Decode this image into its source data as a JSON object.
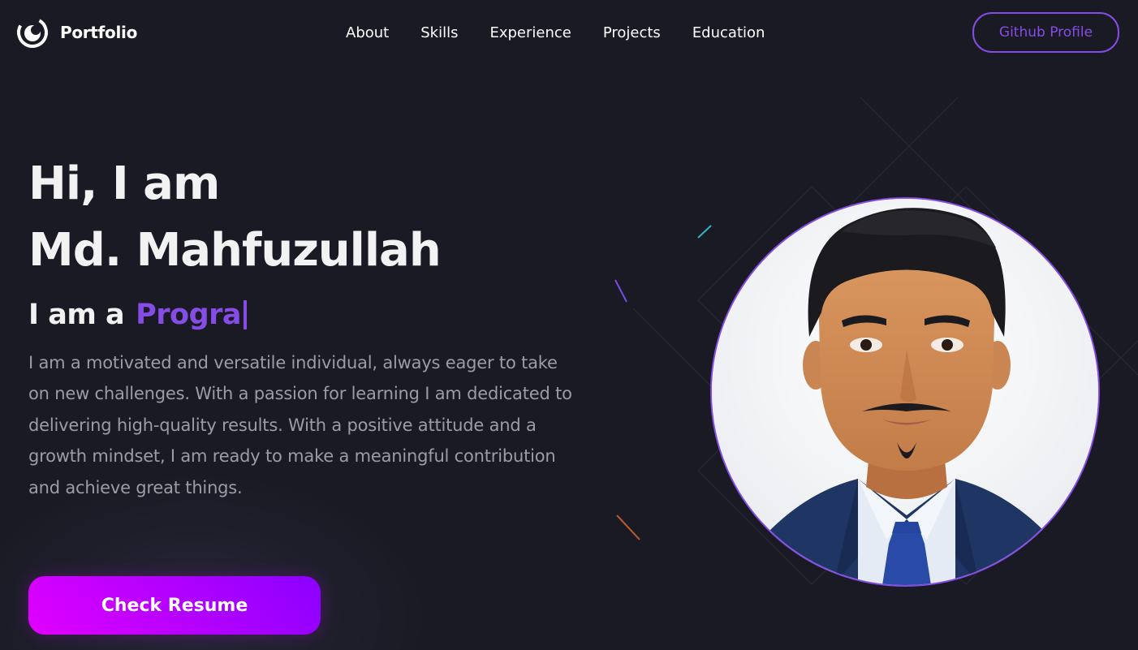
{
  "navbar": {
    "brand": "Portfolio",
    "links": [
      "About",
      "Skills",
      "Experience",
      "Projects",
      "Education"
    ],
    "github_label": "Github Profile"
  },
  "hero": {
    "greeting": "Hi, I am",
    "name": "Md. Mahfuzullah",
    "role_prefix": "I am a",
    "role_typed": "Progra",
    "description": "I am a motivated and versatile individual, always eager to take on new challenges. With a passion for learning I am dedicated to delivering high-quality results. With a positive attitude and a growth mindset, I am ready to make a meaningful contribution and achieve great things.",
    "resume_label": "Check Resume"
  },
  "colors": {
    "background": "#1a1a24",
    "accent": "#854ce6",
    "text_primary": "#f2f2f2",
    "text_secondary": "#9c9ca8",
    "button_gradient_start": "#e100ff",
    "button_gradient_end": "#8a00ff"
  },
  "icons": {
    "brand": "portfolio-logo-icon"
  }
}
